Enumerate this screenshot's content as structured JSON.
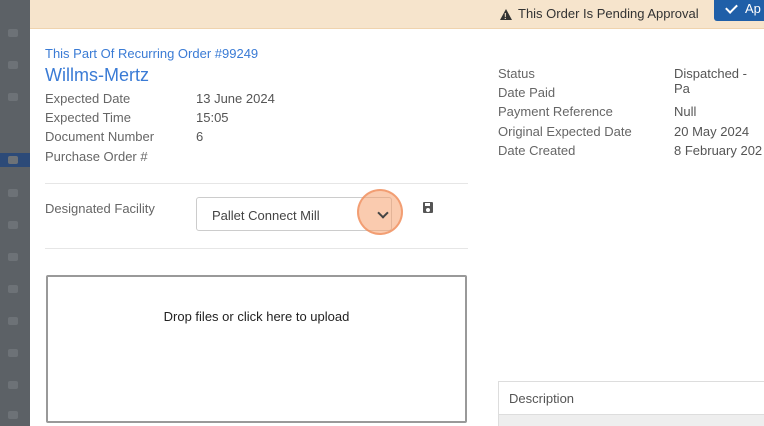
{
  "banner": {
    "warning_text": "This Order Is Pending Approval",
    "approve_label": "Ap"
  },
  "order": {
    "recurring_link": "This Part Of Recurring Order #99249",
    "customer_name": "Willms-Mertz",
    "left_fields": [
      {
        "label": "Expected Date",
        "value": "13 June 2024"
      },
      {
        "label": "Expected Time",
        "value": "15:05"
      },
      {
        "label": "Document Number",
        "value": "6"
      },
      {
        "label": "Purchase Order #",
        "value": ""
      }
    ],
    "right_fields": [
      {
        "label": "Status",
        "value": "Dispatched - Pa"
      },
      {
        "label": "Date Paid",
        "value": ""
      },
      {
        "label": "Payment Reference",
        "value": "Null"
      },
      {
        "label": "Original Expected Date",
        "value": "20 May 2024"
      },
      {
        "label": "Date Created",
        "value": "8 February 202"
      }
    ]
  },
  "facility": {
    "label": "Designated Facility",
    "selected": "Pallet Connect Mill"
  },
  "upload": {
    "text": "Drop files or click here to upload"
  },
  "table": {
    "header": "Description"
  },
  "colors": {
    "accent": "#3a7bd5",
    "banner_bg": "#f6e4cc",
    "button_bg": "#1f5fa8"
  }
}
